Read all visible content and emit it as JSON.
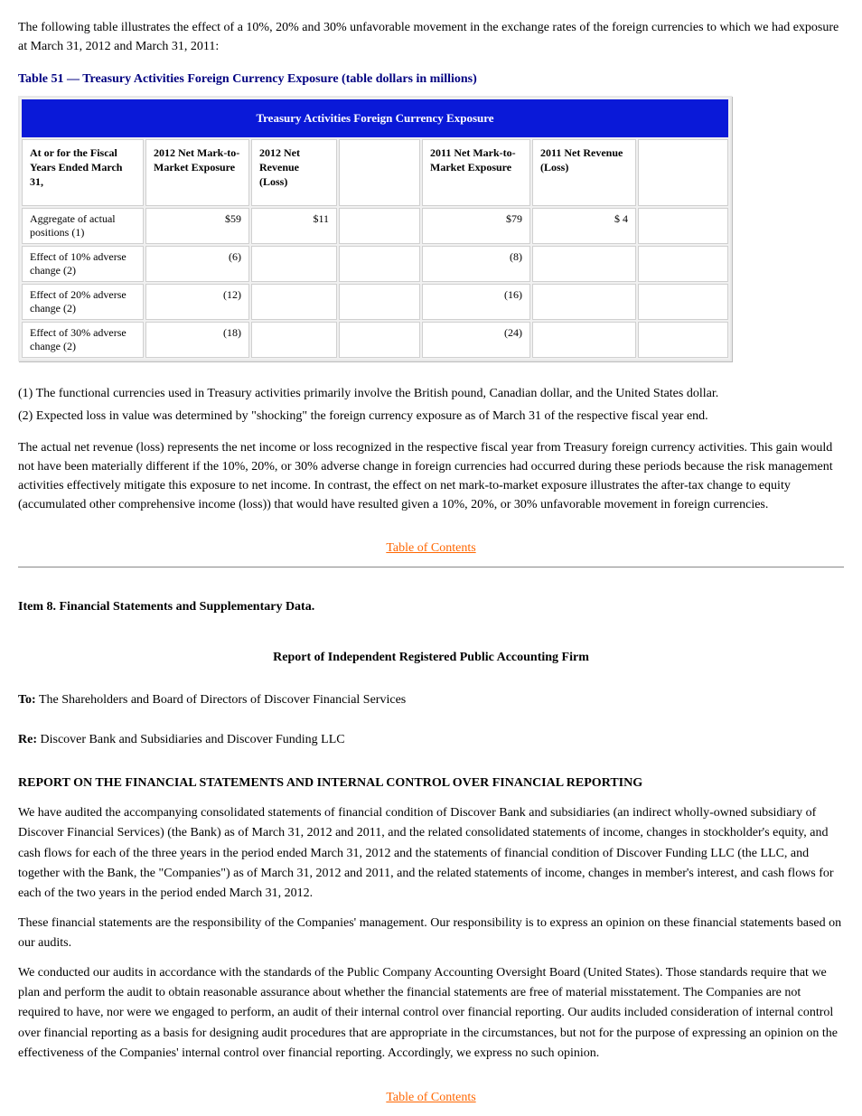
{
  "intro": "The following table illustrates the effect of a 10%, 20% and 30% unfavorable movement in the exchange rates of the foreign currencies to which we had exposure at March 31, 2012 and March 31, 2011:",
  "section_title": "Table 51 — Treasury Activities Foreign Currency Exposure (table dollars in millions)",
  "table": {
    "title": "Treasury Activities Foreign Currency Exposure",
    "headers": [
      "At or for the Fiscal Years Ended March 31,",
      "2012 Net Mark-to-Market Exposure",
      "2012 Net Revenue",
      "2011 Net Mark-to-Market Exposure",
      "2011 Net Revenue"
    ],
    "subheaders_right": [
      "(Loss)",
      "(Loss)"
    ],
    "rows": [
      {
        "label": "Aggregate of actual positions (1)",
        "c1": "$59",
        "c2": "$11",
        "c3": "$79",
        "c4": "$ 4",
        "c5": "",
        "c6": ""
      },
      {
        "label": "Effect of 10% adverse change (2)",
        "c1": "(6)",
        "c2": "",
        "c3": "(8)",
        "c4": "",
        "c5": "",
        "c6": ""
      },
      {
        "label": "Effect of 20% adverse change (2)",
        "c1": "(12)",
        "c2": "",
        "c3": "(16)",
        "c4": "",
        "c5": "",
        "c6": ""
      },
      {
        "label": "Effect of 30% adverse change (2)",
        "c1": "(18)",
        "c2": "",
        "c3": "(24)",
        "c4": "",
        "c5": "",
        "c6": ""
      }
    ]
  },
  "notes": [
    "(1) The functional currencies used in Treasury activities primarily involve the British pound, Canadian dollar, and the United States dollar.",
    "(2) Expected loss in value was determined by \"shocking\" the foreign currency exposure as of March 31 of the respective fiscal year end."
  ],
  "fmt_para": "The actual net revenue (loss) represents the net income or loss recognized in the respective fiscal year from Treasury foreign currency activities. This gain would not have been materially different if the 10%, 20%, or 30% adverse change in foreign currencies had occurred during these periods because the risk management activities effectively mitigate this exposure to net income. In contrast, the effect on net mark-to-market exposure illustrates the after-tax change to equity (accumulated other comprehensive income (loss)) that would have resulted given a 10%, 20%, or 30% unfavorable movement in foreign currencies.",
  "footer_link": "Table of Contents",
  "page2": {
    "title": "Item 8. Financial Statements and Supplementary Data.",
    "auditor_heading": "Report of Independent Registered Public Accounting Firm",
    "blocks": [
      {
        "label": "To:",
        "text": "The Shareholders and Board of Directors of Discover Financial Services"
      },
      {
        "label": "Re:",
        "text": "Discover Bank and Subsidiaries and Discover Funding LLC"
      }
    ],
    "escrow_heading": "REPORT ON THE FINANCIAL STATEMENTS AND INTERNAL CONTROL OVER FINANCIAL REPORTING",
    "escrow_para1": "We have audited the accompanying consolidated statements of financial condition of Discover Bank and subsidiaries (an indirect wholly-owned subsidiary of Discover Financial Services) (the Bank) as of March 31, 2012 and 2011, and the related consolidated statements of income, changes in stockholder's equity, and cash flows for each of the three years in the period ended March 31, 2012 and the statements of financial condition of Discover Funding LLC (the LLC, and together with the Bank, the \"Companies\") as of March 31, 2012 and 2011, and the related statements of income, changes in member's interest, and cash flows for each of the two years in the period ended March 31, 2012.",
    "escrow_para2": "These financial statements are the responsibility of the Companies' management. Our responsibility is to express an opinion on these financial statements based on our audits.",
    "escrow_para3": "We conducted our audits in accordance with the standards of the Public Company Accounting Oversight Board (United States). Those standards require that we plan and perform the audit to obtain reasonable assurance about whether the financial statements are free of material misstatement. The Companies are not required to have, nor were we engaged to perform, an audit of their internal control over financial reporting. Our audits included consideration of internal control over financial reporting as a basis for designing audit procedures that are appropriate in the circumstances, but not for the purpose of expressing an opinion on the effectiveness of the Companies' internal control over financial reporting. Accordingly, we express no such opinion."
  },
  "footer_link_2": "Table of Contents"
}
